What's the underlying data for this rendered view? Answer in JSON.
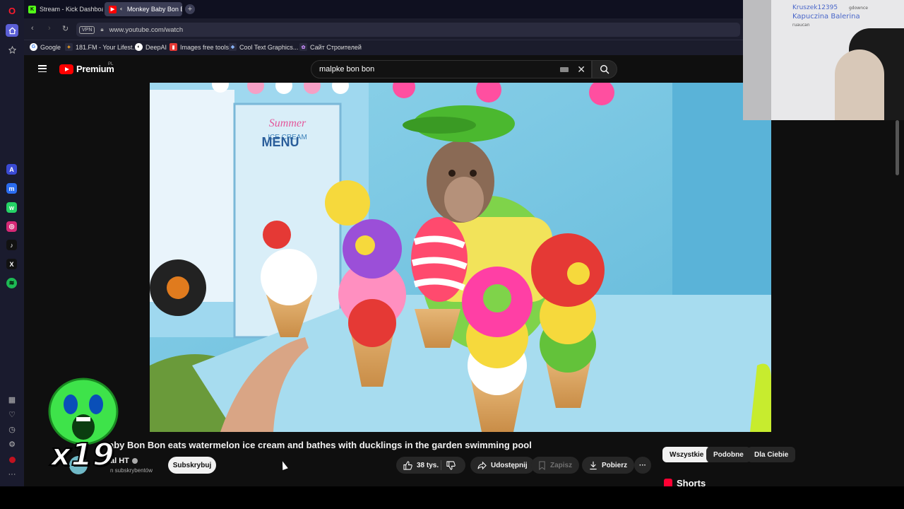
{
  "browser": {
    "tabs": [
      {
        "label": "Stream - Kick Dashboard",
        "icon": "kick-icon",
        "active": false
      },
      {
        "label": "Monkey Baby Bon Bo",
        "icon": "youtube-icon",
        "active": true
      }
    ],
    "new_tab": "+",
    "url": "www.youtube.com/watch",
    "vpn_label": "VPN",
    "bookmarks": [
      {
        "label": "Google",
        "icon": "google-icon"
      },
      {
        "label": "181.FM - Your Lifest...",
        "icon": "radio-icon"
      },
      {
        "label": "DeepAI",
        "icon": "deepai-icon"
      },
      {
        "label": "Images free tools",
        "icon": "images-icon"
      },
      {
        "label": "Cool Text Graphics...",
        "icon": "cooltext-icon"
      },
      {
        "label": "Сайт Строителей",
        "icon": "site-icon"
      }
    ]
  },
  "sidebar": {
    "apps": [
      "aria-icon",
      "messenger-icon",
      "whatsapp-icon",
      "instagram-icon",
      "tiktok-icon",
      "x-icon",
      "spotify-icon"
    ],
    "bottom": [
      "grid-icon",
      "heart-icon",
      "history-icon",
      "settings-icon",
      "ublock-icon",
      "more-icon"
    ]
  },
  "youtube": {
    "logo_text": "Premium",
    "logo_region": "PL",
    "search_value": "malpke bon bon",
    "video": {
      "title": "aby Bon Bon eats watermelon ice cream and bathes with ducklings in the garden swimming pool",
      "channel": "al HT",
      "subscribers": "n subskrybentów",
      "subscribe_label": "Subskrybuj",
      "likes": "38 tys.",
      "share_label": "Udostępnij",
      "save_label": "Zapisz",
      "download_label": "Pobierz",
      "more_label": "···"
    },
    "chips": [
      {
        "label": "Wszystkie",
        "active": true
      },
      {
        "label": "Podobne",
        "active": false
      },
      {
        "label": "Dla Ciebie",
        "active": false
      }
    ],
    "shorts_label": "Shorts",
    "video_scene": {
      "sign_text": "MENU",
      "sign_sub": "Summer",
      "sign_sub2": "ICE CREAM"
    }
  },
  "overlays": {
    "emote_count": "x19",
    "whiteboard": [
      "Kruszek12395",
      "Kapuczina Balerina",
      "gdownce",
      "ruaucan"
    ]
  },
  "colors": {
    "yt_bg": "#0f0f0f",
    "yt_red": "#ff0000",
    "browser_bg": "#1b1c2c"
  }
}
